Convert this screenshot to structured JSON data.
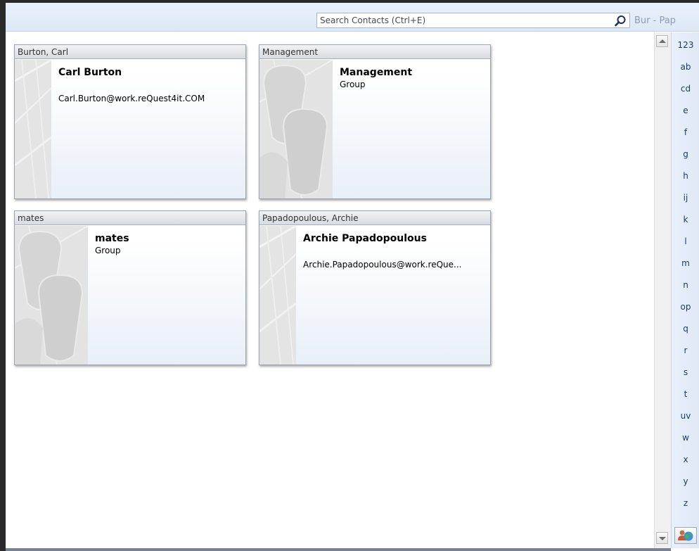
{
  "search": {
    "placeholder": "Search Contacts (Ctrl+E)",
    "value": ""
  },
  "range_label": "Bur - Pap",
  "cards": [
    {
      "header": "Burton, Carl",
      "name": "Carl Burton",
      "detail": "Carl.Burton@work.reQuest4it.COM",
      "kind": "contact"
    },
    {
      "header": "Management",
      "name": "Management",
      "detail": "Group",
      "kind": "group"
    },
    {
      "header": "mates",
      "name": "mates",
      "detail": "Group",
      "kind": "group"
    },
    {
      "header": "Papadopoulous, Archie",
      "name": "Archie Papadopoulous",
      "detail": "Archie.Papadopoulous@work.reQue...",
      "kind": "contact"
    }
  ],
  "index": [
    "123",
    "ab",
    "cd",
    "e",
    "f",
    "g",
    "h",
    "ij",
    "k",
    "l",
    "m",
    "n",
    "op",
    "q",
    "r",
    "s",
    "t",
    "uv",
    "w",
    "x",
    "y",
    "z"
  ],
  "icons": {
    "search": "search-icon",
    "scroll_up": "scroll-up-arrow-icon",
    "scroll_down": "scroll-down-arrow-icon",
    "address_book": "contacts-globe-icon"
  },
  "colors": {
    "header_bg": "#dde8f6",
    "index_text": "#1e3c66",
    "range_text": "#8d9bb0"
  }
}
